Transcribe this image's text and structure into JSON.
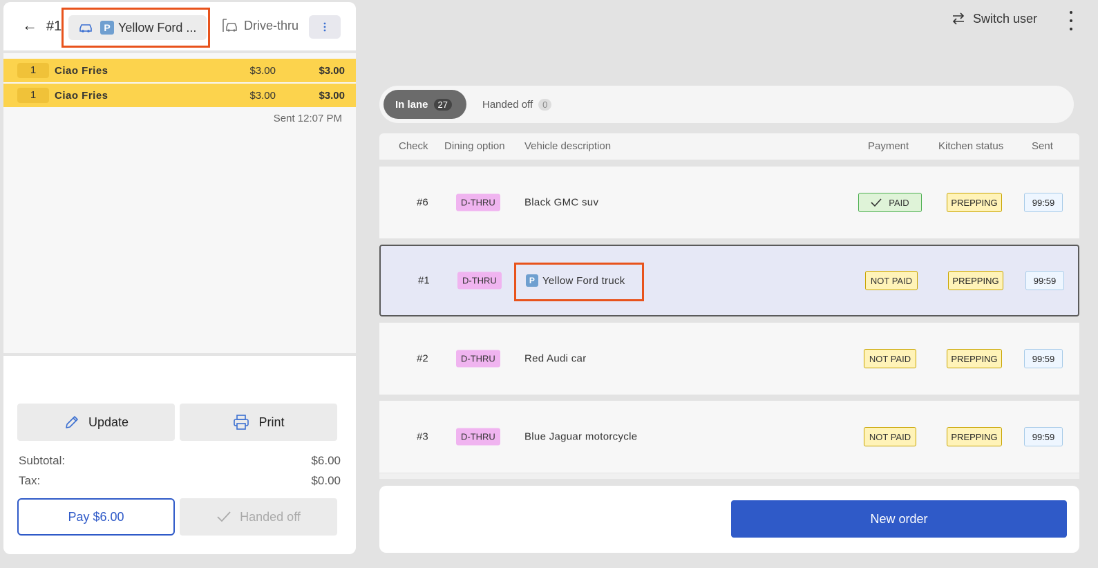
{
  "left_panel": {
    "check_number": "#1",
    "vehicle_chip_text": "Yellow Ford ...",
    "parking_glyph": "P",
    "dining_option": "Drive-thru",
    "items": [
      {
        "qty": "1",
        "name": "Ciao Fries",
        "price": "$3.00",
        "total": "$3.00"
      },
      {
        "qty": "1",
        "name": "Ciao Fries",
        "price": "$3.00",
        "total": "$3.00"
      }
    ],
    "sent_time": "Sent 12:07 PM",
    "update_label": "Update",
    "print_label": "Print",
    "subtotal_label": "Subtotal:",
    "subtotal_value": "$6.00",
    "tax_label": "Tax:",
    "tax_value": "$0.00",
    "pay_label": "Pay $6.00",
    "handed_off_label": "Handed off"
  },
  "header": {
    "switch_user_label": "Switch user"
  },
  "tabs": [
    {
      "label": "In lane",
      "count": "27",
      "active": true
    },
    {
      "label": "Handed off",
      "count": "0",
      "active": false
    }
  ],
  "table": {
    "columns": [
      "Check",
      "Dining option",
      "Vehicle description",
      "Payment",
      "Kitchen status",
      "Sent"
    ],
    "rows": [
      {
        "check": "#6",
        "dining": "D-THRU",
        "vehicle": "Black GMC suv",
        "payment": "PAID",
        "kitchen": "PREPPING",
        "sent": "99:59"
      },
      {
        "check": "#1",
        "dining": "D-THRU",
        "vehicle": "Yellow Ford truck",
        "payment": "NOT PAID",
        "kitchen": "PREPPING",
        "sent": "99:59"
      },
      {
        "check": "#2",
        "dining": "D-THRU",
        "vehicle": "Red Audi car",
        "payment": "NOT PAID",
        "kitchen": "PREPPING",
        "sent": "99:59"
      },
      {
        "check": "#3",
        "dining": "D-THRU",
        "vehicle": "Blue Jaguar motorcycle",
        "payment": "NOT PAID",
        "kitchen": "PREPPING",
        "sent": "99:59"
      }
    ]
  },
  "new_order_label": "New order",
  "colors": {
    "accent": "#2f5ac8",
    "highlight": "#e8531c",
    "item_bg": "#fcd34d",
    "dthru_badge": "#f0b4f0"
  }
}
